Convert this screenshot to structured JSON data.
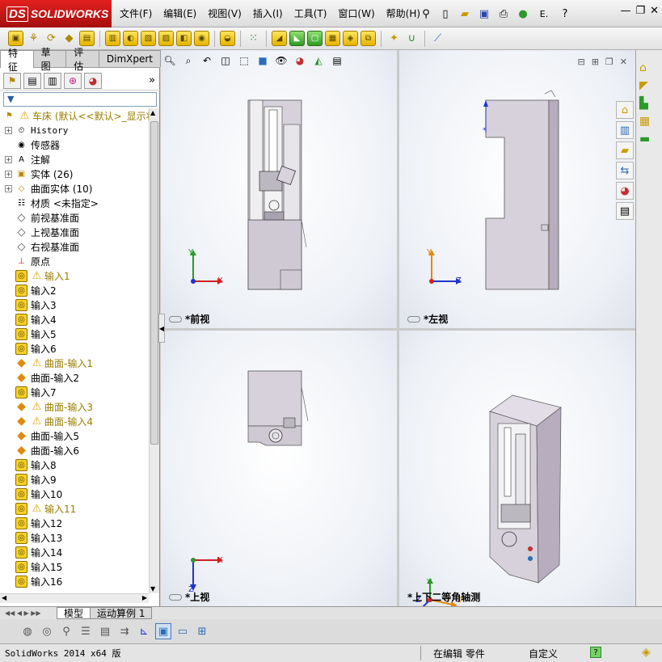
{
  "app": {
    "brand": "SOLIDWORKS",
    "brand_prefix": "DS"
  },
  "menu": [
    "文件(F)",
    "编辑(E)",
    "视图(V)",
    "插入(I)",
    "工具(T)",
    "窗口(W)",
    "帮助(H)"
  ],
  "quickbar": {
    "options_label": "E.",
    "help_label": "?"
  },
  "panel_tabs": [
    "特征",
    "草图",
    "评估",
    "DimXpert"
  ],
  "tree": {
    "root": "车床  (默认<<默认>_显示状",
    "items": [
      {
        "label": "History",
        "icon": "history-icon",
        "expand": true,
        "warn": false,
        "mono": true
      },
      {
        "label": "传感器",
        "icon": "sensor-icon",
        "expand": false,
        "warn": false
      },
      {
        "label": "注解",
        "icon": "annotation-icon",
        "expand": true,
        "warn": false
      },
      {
        "label": "实体 (26)",
        "icon": "solid-bodies-icon",
        "expand": true,
        "warn": false
      },
      {
        "label": "曲面实体 (10)",
        "icon": "surface-bodies-icon",
        "expand": true,
        "warn": false
      },
      {
        "label": "材质 <未指定>",
        "icon": "material-icon",
        "expand": false,
        "warn": false
      },
      {
        "label": "前视基准面",
        "icon": "plane-icon",
        "expand": false,
        "warn": false
      },
      {
        "label": "上视基准面",
        "icon": "plane-icon",
        "expand": false,
        "warn": false
      },
      {
        "label": "右视基准面",
        "icon": "plane-icon",
        "expand": false,
        "warn": false
      },
      {
        "label": "原点",
        "icon": "origin-icon",
        "expand": false,
        "warn": false
      },
      {
        "label": "输入1",
        "icon": "import-feature-icon",
        "expand": false,
        "warn": true
      },
      {
        "label": "输入2",
        "icon": "import-feature-icon",
        "expand": false,
        "warn": false
      },
      {
        "label": "输入3",
        "icon": "import-feature-icon",
        "expand": false,
        "warn": false
      },
      {
        "label": "输入4",
        "icon": "import-feature-icon",
        "expand": false,
        "warn": false
      },
      {
        "label": "输入5",
        "icon": "import-feature-icon",
        "expand": false,
        "warn": false
      },
      {
        "label": "输入6",
        "icon": "import-feature-icon",
        "expand": false,
        "warn": false
      },
      {
        "label": "曲面-输入1",
        "icon": "surface-import-icon",
        "expand": false,
        "warn": true
      },
      {
        "label": "曲面-输入2",
        "icon": "surface-import-icon",
        "expand": false,
        "warn": false
      },
      {
        "label": "输入7",
        "icon": "import-feature-icon",
        "expand": false,
        "warn": false
      },
      {
        "label": "曲面-输入3",
        "icon": "surface-import-icon",
        "expand": false,
        "warn": true
      },
      {
        "label": "曲面-输入4",
        "icon": "surface-import-icon",
        "expand": false,
        "warn": true
      },
      {
        "label": "曲面-输入5",
        "icon": "surface-import-icon",
        "expand": false,
        "warn": false
      },
      {
        "label": "曲面-输入6",
        "icon": "surface-import-icon",
        "expand": false,
        "warn": false
      },
      {
        "label": "输入8",
        "icon": "import-feature-icon",
        "expand": false,
        "warn": false
      },
      {
        "label": "输入9",
        "icon": "import-feature-icon",
        "expand": false,
        "warn": false
      },
      {
        "label": "输入10",
        "icon": "import-feature-icon",
        "expand": false,
        "warn": false
      },
      {
        "label": "输入11",
        "icon": "import-feature-icon",
        "expand": false,
        "warn": true
      },
      {
        "label": "输入12",
        "icon": "import-feature-icon",
        "expand": false,
        "warn": false
      },
      {
        "label": "输入13",
        "icon": "import-feature-icon",
        "expand": false,
        "warn": false
      },
      {
        "label": "输入14",
        "icon": "import-feature-icon",
        "expand": false,
        "warn": false
      },
      {
        "label": "输入15",
        "icon": "import-feature-icon",
        "expand": false,
        "warn": false
      },
      {
        "label": "输入16",
        "icon": "import-feature-icon",
        "expand": false,
        "warn": false
      }
    ]
  },
  "views": {
    "front": "*前视",
    "left": "*左视",
    "top": "*上视",
    "iso": "*上下二等角轴测"
  },
  "axes": {
    "x": "X",
    "y": "Y",
    "z": "Z"
  },
  "bottom_tabs": [
    "模型",
    "运动算例 1"
  ],
  "status": {
    "app_version": "SolidWorks 2014 x64 版",
    "mode": "在编辑 零件",
    "custom": "自定义",
    "help": "?"
  },
  "colors": {
    "brand_red": "#c8181a",
    "part_gray": "#d6d1da",
    "part_side": "#b7adbf",
    "axis_red": "#d21f1f",
    "axis_green": "#2a9a2a",
    "axis_blue": "#2233cc"
  }
}
